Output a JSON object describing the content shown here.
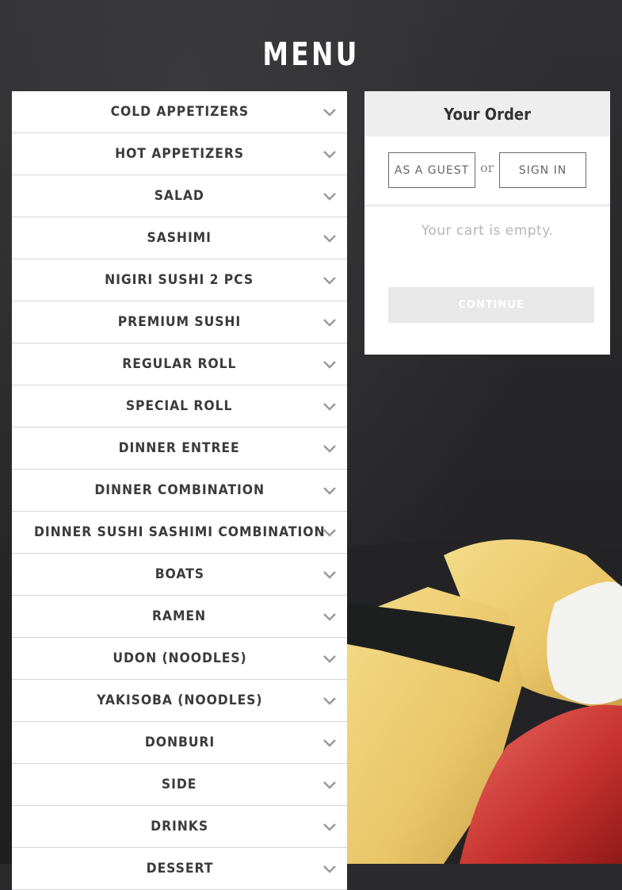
{
  "header": {
    "title": "MENU"
  },
  "menu": {
    "categories": [
      "COLD APPETIZERS",
      "HOT APPETIZERS",
      "SALAD",
      "SASHIMI",
      "NIGIRI SUSHI 2 PCS",
      "PREMIUM SUSHI",
      "REGULAR ROLL",
      "SPECIAL ROLL",
      "DINNER ENTREE",
      "DINNER COMBINATION",
      "DINNER SUSHI SASHIMI COMBINATION",
      "BOATS",
      "RAMEN",
      "UDON (NOODLES)",
      "YAKISOBA (NOODLES)",
      "DONBURI",
      "SIDE",
      "DRINKS",
      "DESSERT"
    ],
    "expand_icon": "chevron-down-icon"
  },
  "order": {
    "title": "Your Order",
    "guest_label": "AS A GUEST",
    "or_label": "or",
    "signin_label": "SIGN IN",
    "empty_text": "Your cart is empty.",
    "continue_label": "CONTINUE"
  },
  "colors": {
    "background": "#2b2b2d",
    "brand_red": "#c8102e",
    "text_dark": "#3b3b3b",
    "muted": "#b5b5b5"
  }
}
